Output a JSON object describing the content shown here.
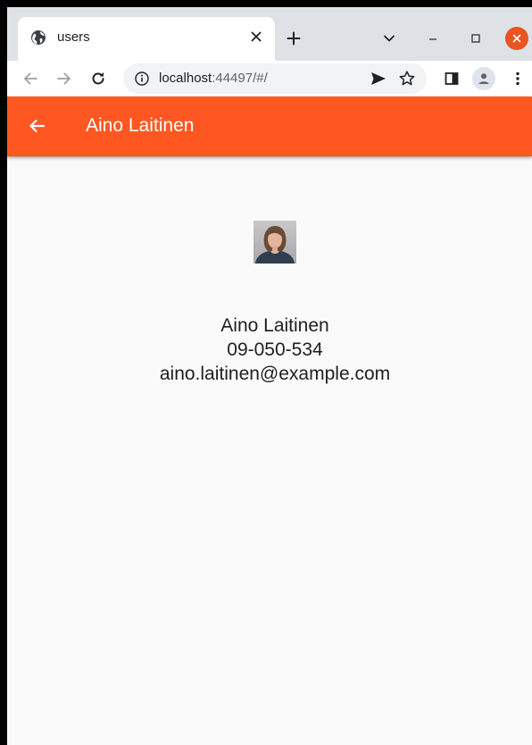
{
  "browser": {
    "tab": {
      "title": "users",
      "favicon": "globe-icon"
    },
    "address_bar": {
      "host": "localhost",
      "rest": ":44497/#/"
    },
    "colors": {
      "close_button": "#e95420",
      "tabstrip": "#dee1e6"
    }
  },
  "app": {
    "title": "Aino Laitinen",
    "accent_color": "#ff5722",
    "user": {
      "name": "Aino Laitinen",
      "phone": "09-050-534",
      "email": "aino.laitinen@example.com"
    }
  }
}
